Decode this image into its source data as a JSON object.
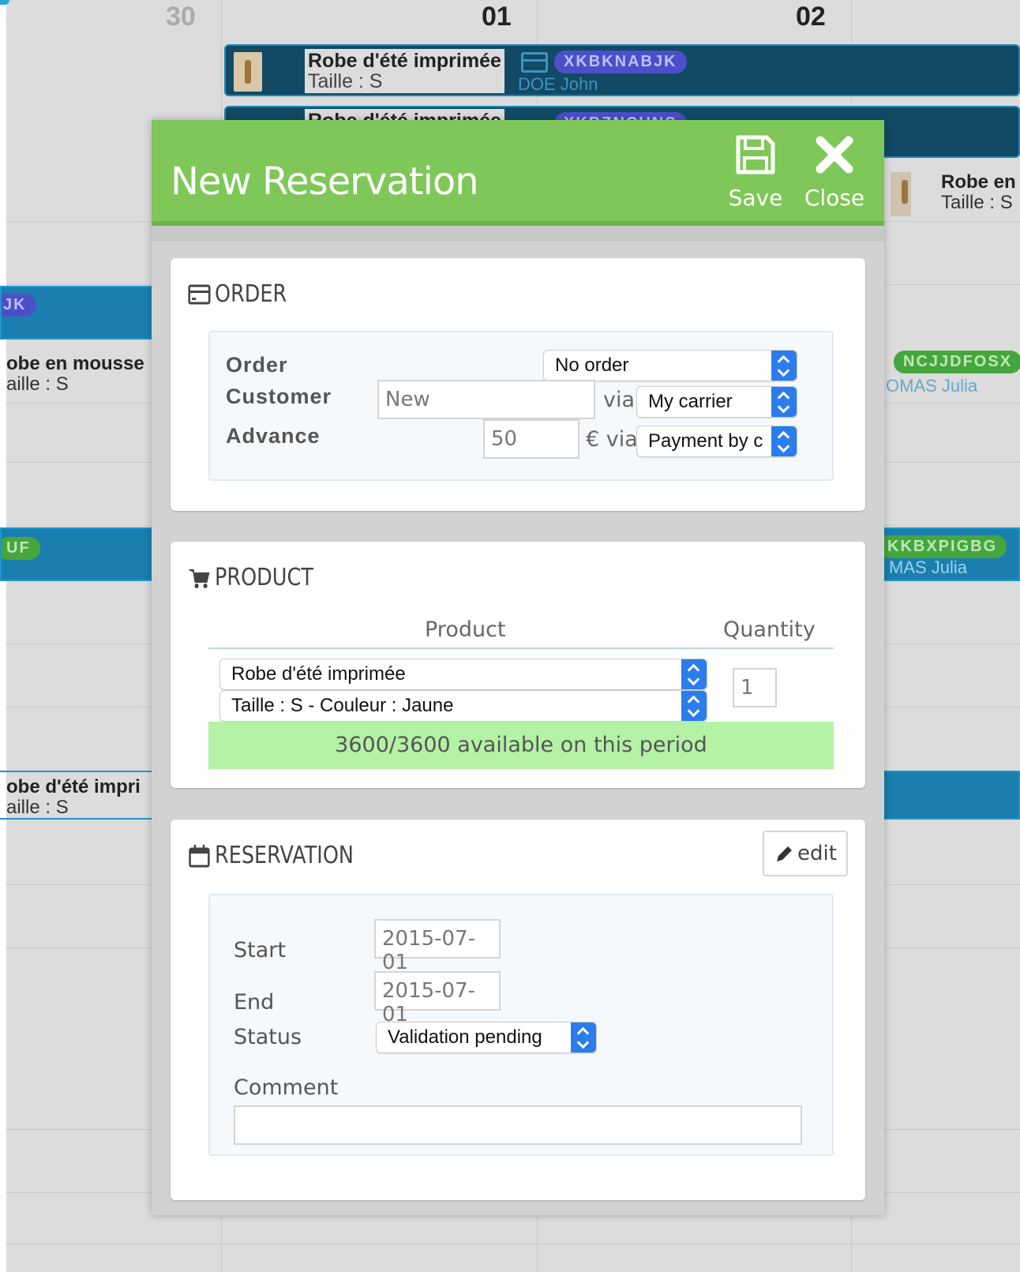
{
  "calendar": {
    "day_30": "30",
    "day_01": "01",
    "day_02": "02",
    "events": [
      {
        "title": "Robe d'été imprimée",
        "size": "Taille : S",
        "badge": "XKBKNABJK",
        "client": "DOE John"
      },
      {
        "title": "Robe d'été imprimée",
        "badge": "XKBZNCUNS"
      },
      {
        "title": "Robe en",
        "size": "Taille : S"
      }
    ],
    "side": [
      {
        "badge": "JK"
      },
      {
        "title": "obe en mousse",
        "size": "aille : S"
      },
      {
        "badge": "NCJJDFOSX",
        "client": "OMAS Julia"
      },
      {
        "badge": "UF"
      },
      {
        "badge": "KKBXPIGBG",
        "client": "MAS Julia"
      },
      {
        "title": "obe d'été impri",
        "size": "aille : S"
      }
    ]
  },
  "modal": {
    "title": "New Reservation",
    "save_label": "Save",
    "close_label": "Close"
  },
  "order": {
    "heading": "ORDER",
    "order_label": "Order",
    "order_select": "No order",
    "customer_label": "Customer",
    "customer_value": "New",
    "via_label": "via",
    "carrier_select": "My carrier",
    "advance_label": "Advance",
    "advance_value": "50",
    "euro_via_label": "€ via",
    "payment_select": "Payment by c"
  },
  "product": {
    "heading": "PRODUCT",
    "col_product": "Product",
    "col_quantity": "Quantity",
    "product_select": "Robe d'été imprimée",
    "variant_select": "Taille : S - Couleur : Jaune",
    "quantity_value": "1",
    "availability": "3600/3600 available on this period"
  },
  "reservation": {
    "heading": "RESERVATION",
    "edit_label": "edit",
    "start_label": "Start",
    "start_value": "2015-07-01",
    "end_label": "End",
    "end_value": "2015-07-01",
    "status_label": "Status",
    "status_select": "Validation pending",
    "comment_label": "Comment",
    "comment_value": ""
  },
  "colors": {
    "header_green": "#7fc758",
    "select_arrow_blue": "#2b7ded",
    "availability_green": "#b4f2a6",
    "event_dark_blue": "#124a66",
    "event_cyan": "#1a7fae"
  }
}
